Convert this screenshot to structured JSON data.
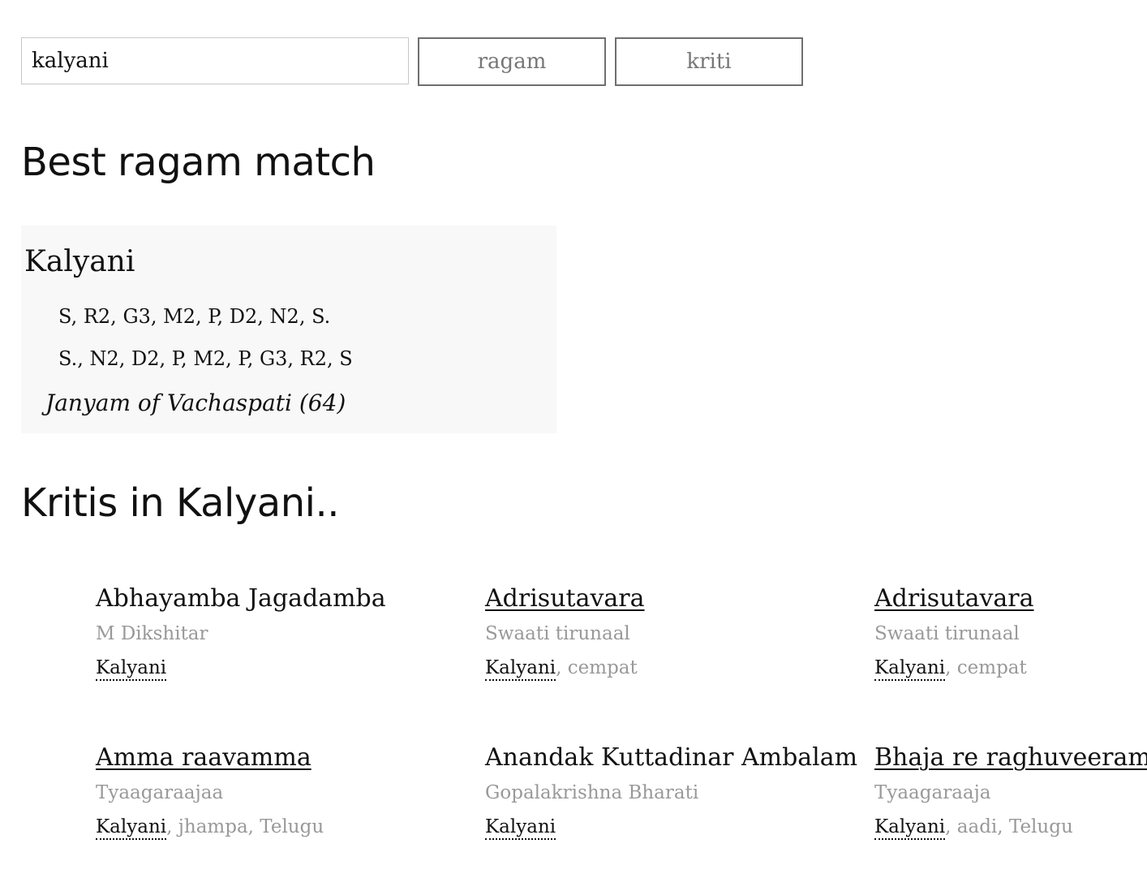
{
  "search": {
    "query": "kalyani",
    "ragam_button": "ragam",
    "kriti_button": "kriti"
  },
  "best_match": {
    "heading": "Best ragam match",
    "ragam_name": "Kalyani",
    "arohanam": "S, R2, G3, M2, P, D2, N2, S.",
    "avarohanam": "S., N2, D2, P, M2, P, G3, R2, S",
    "janyam": "Janyam of Vachaspati (64)"
  },
  "kritis": {
    "heading": "Kritis in Kalyani..",
    "items": [
      {
        "title": "Abhayamba Jagadamba",
        "linked": false,
        "composer": "M Dikshitar",
        "ragam": "Kalyani",
        "extra": ""
      },
      {
        "title": "Adrisutavara",
        "linked": true,
        "composer": "Swaati tirunaal",
        "ragam": "Kalyani",
        "extra": ", cempat"
      },
      {
        "title": "Adrisutavara",
        "linked": true,
        "composer": "Swaati tirunaal",
        "ragam": "Kalyani",
        "extra": ", cempat"
      },
      {
        "title": "Amma raavamma",
        "linked": true,
        "composer": "Tyaagaraajaa",
        "ragam": "Kalyani",
        "extra": ", jhampa, Telugu"
      },
      {
        "title": "Anandak Kuttadinar Ambalam",
        "linked": false,
        "composer": "Gopalakrishna Bharati",
        "ragam": "Kalyani",
        "extra": ""
      },
      {
        "title": "Bhaja re raghuveeram",
        "linked": true,
        "composer": "Tyaagaraaja",
        "ragam": "Kalyani",
        "extra": ", aadi, Telugu"
      }
    ]
  }
}
